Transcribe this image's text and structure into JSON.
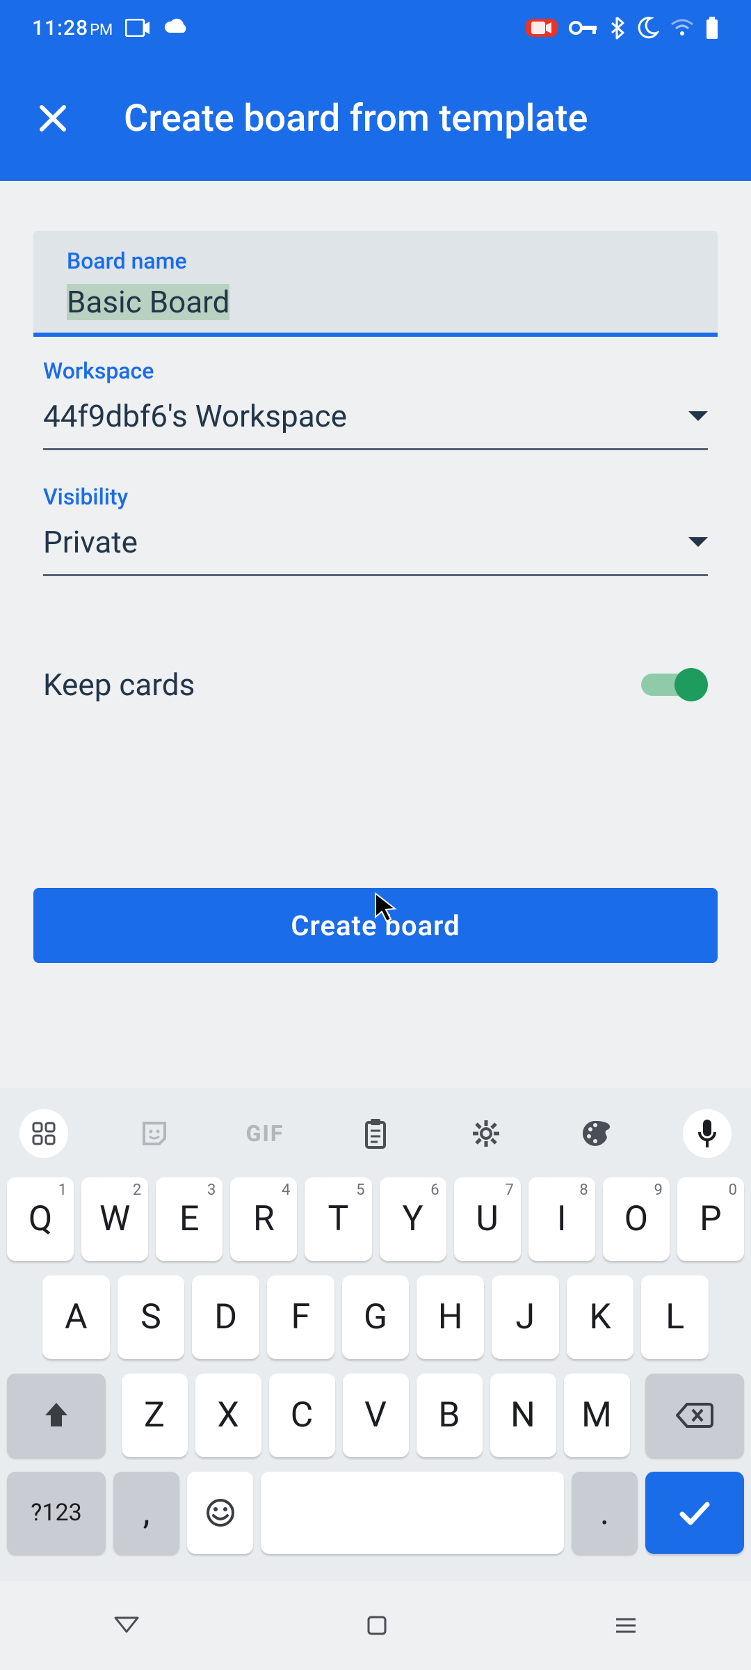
{
  "status": {
    "time": "11:28",
    "ampm": "PM"
  },
  "header": {
    "title": "Create board from template"
  },
  "form": {
    "boardname_label": "Board name",
    "boardname_value": "Basic Board",
    "workspace_label": "Workspace",
    "workspace_value": "44f9dbf6's Workspace",
    "visibility_label": "Visibility",
    "visibility_value": "Private",
    "keep_cards_label": "Keep cards",
    "keep_cards_on": true,
    "create_button": "Create board"
  },
  "keyboard": {
    "gif": "GIF",
    "row1": [
      "Q",
      "W",
      "E",
      "R",
      "T",
      "Y",
      "U",
      "I",
      "O",
      "P"
    ],
    "row1_sup": [
      "1",
      "2",
      "3",
      "4",
      "5",
      "6",
      "7",
      "8",
      "9",
      "0"
    ],
    "row2": [
      "A",
      "S",
      "D",
      "F",
      "G",
      "H",
      "J",
      "K",
      "L"
    ],
    "row3": [
      "Z",
      "X",
      "C",
      "V",
      "B",
      "N",
      "M"
    ],
    "numkey": "?123",
    "comma": ",",
    "period": "."
  }
}
